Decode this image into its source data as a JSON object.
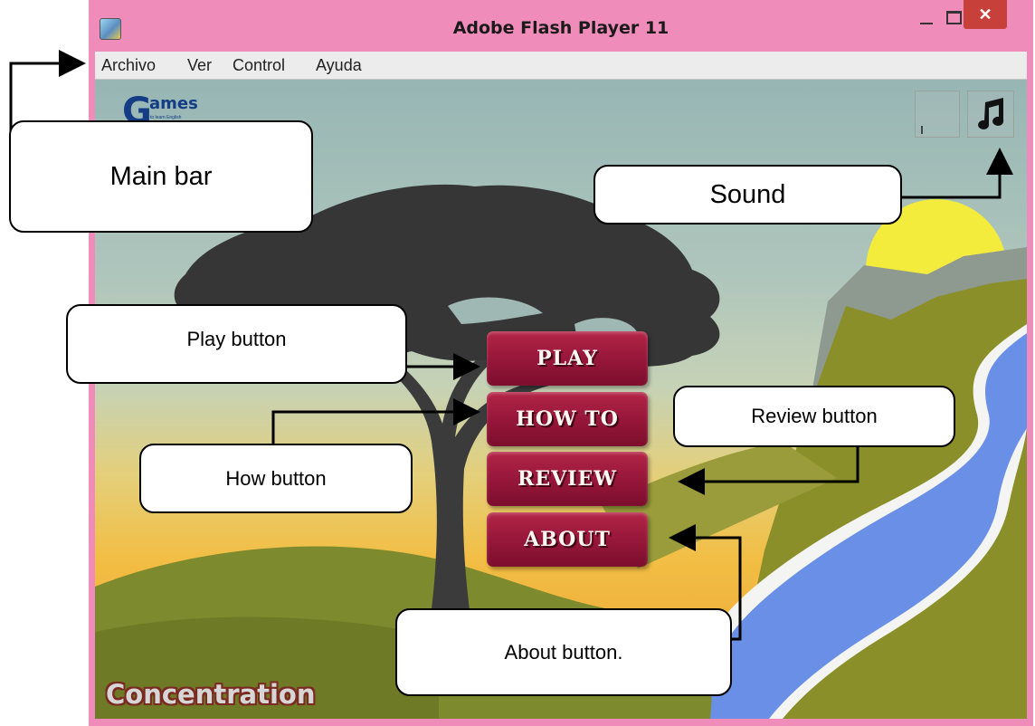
{
  "window": {
    "title": "Adobe Flash Player 11",
    "close_glyph": "✕"
  },
  "menubar": {
    "items": [
      "Archivo",
      "Ver",
      "Control",
      "Ayuda"
    ]
  },
  "game": {
    "logo_letter": "G",
    "logo_word": "ames",
    "logo_tagline": "to learn English",
    "buttons": {
      "play": "PLAY",
      "howto": "HOW TO",
      "review": "REVIEW",
      "about": "ABOUT"
    },
    "title": "Concentration",
    "music_icon": "music-note-icon"
  },
  "annotations": {
    "main_bar": "Main bar",
    "sound": "Sound",
    "play": "Play button",
    "how": "How button",
    "review": "Review button",
    "about": "About button."
  },
  "colors": {
    "frame": "#f08cba",
    "button": "#97173a",
    "close": "#c7403a"
  }
}
